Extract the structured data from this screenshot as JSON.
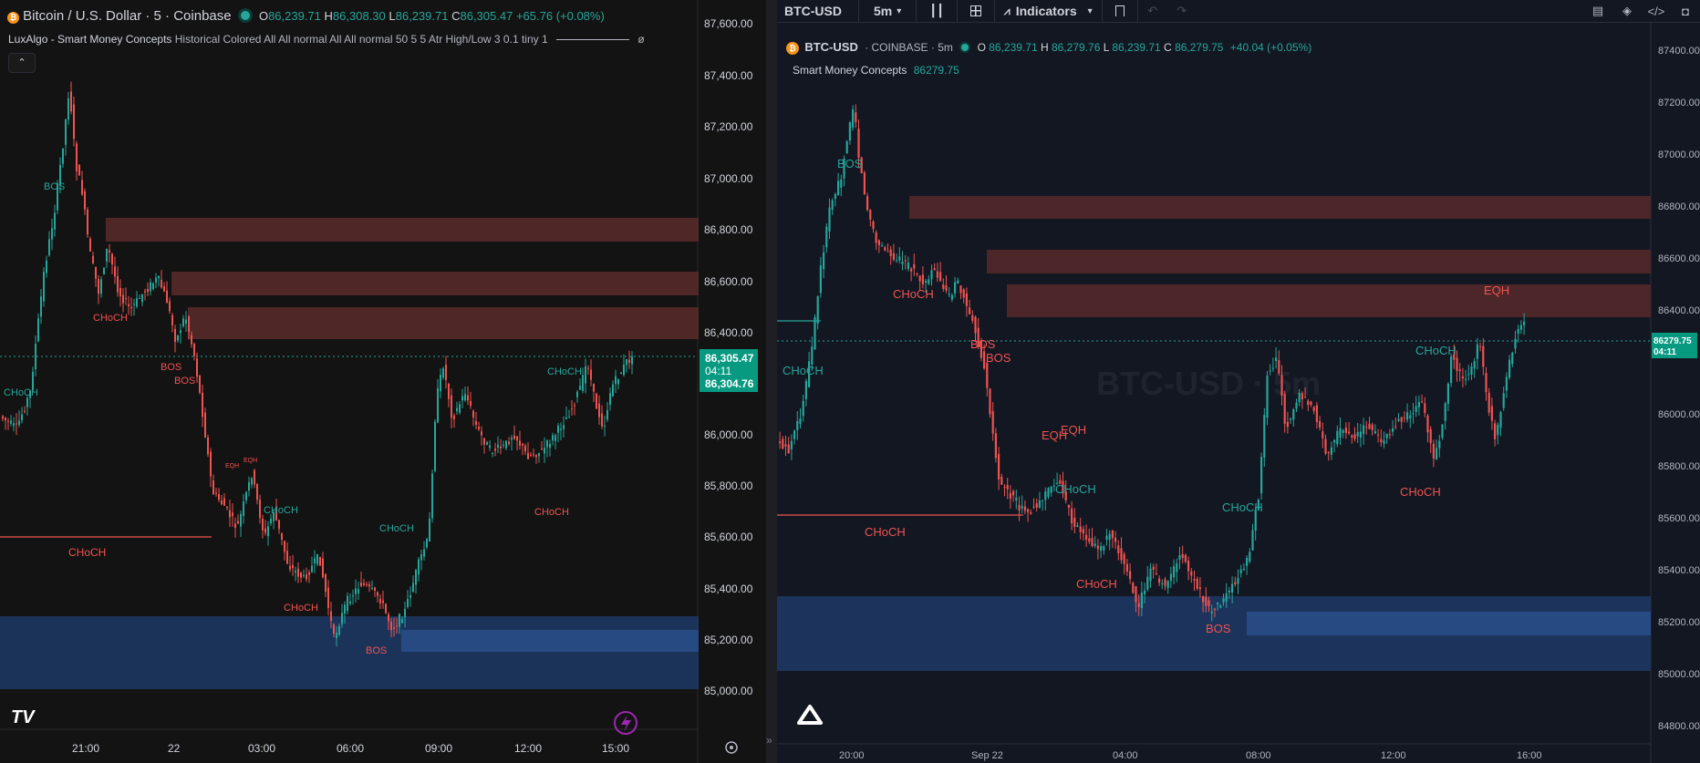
{
  "left": {
    "symbol_title": "Bitcoin / U.S. Dollar · 5 · Coinbase",
    "ohlc": {
      "o_label": "O",
      "o": "86,239.71",
      "h_label": "H",
      "h": "86,308.30",
      "l_label": "L",
      "l": "86,239.71",
      "c_label": "C",
      "c": "86,305.47",
      "change": "+65.76 (+0.08%)"
    },
    "indicator_name": "LuxAlgo - Smart Money Concepts",
    "indicator_params": "Historical Colored All All normal All All normal 50 5 5 Atr High/Low 3 0.1 tiny 1",
    "indicator_tail": "ø",
    "price_axis": [
      "87,600.00",
      "87,400.00",
      "87,200.00",
      "87,000.00",
      "86,800.00",
      "86,600.00",
      "86,400.00",
      "86,000.00",
      "85,800.00",
      "85,600.00",
      "85,400.00",
      "85,200.00",
      "85,000.00"
    ],
    "price_badge": {
      "price": "86,305.47",
      "countdown": "04:11",
      "bid": "86,304.76"
    },
    "time_axis": [
      "21:00",
      "22",
      "03:00",
      "06:00",
      "09:00",
      "12:00",
      "15:00"
    ],
    "labels": {
      "bos": "BOS",
      "choch": "CHoCH",
      "eqh": "EQH"
    },
    "logo": "TV"
  },
  "right": {
    "toolbar": {
      "symbol": "BTC-USD",
      "interval": "5m",
      "indicators": "Indicators"
    },
    "legend": {
      "symbol": "BTC-USD",
      "exchange": "· COINBASE · 5m",
      "o_label": "O",
      "o": "86,239.71",
      "h_label": "H",
      "h": "86,279.76",
      "l_label": "L",
      "l": "86,239.71",
      "c_label": "C",
      "c": "86,279.75",
      "change": "+40.04 (+0.05%)"
    },
    "indicator_name": "Smart Money Concepts",
    "indicator_value": "86279.75",
    "watermark": "BTC-USD · 5m",
    "price_axis": [
      "87400.00",
      "87200.00",
      "87000.00",
      "86800.00",
      "86600.00",
      "86400.00",
      "86000.00",
      "85800.00",
      "85600.00",
      "85400.00",
      "85200.00",
      "85000.00",
      "84800.00"
    ],
    "price_badge": {
      "price": "86279.75",
      "countdown": "04:11"
    },
    "time_axis": [
      "20:00",
      "Sep 22",
      "04:00",
      "08:00",
      "12:00",
      "16:00"
    ],
    "labels": {
      "bos": "BOS",
      "choch": "CHoCH",
      "eqh": "EQH"
    }
  },
  "colors": {
    "up": "#26a69a",
    "down": "#ef5350",
    "supply": "#5b2b2b",
    "demand": "#1f3a66"
  }
}
